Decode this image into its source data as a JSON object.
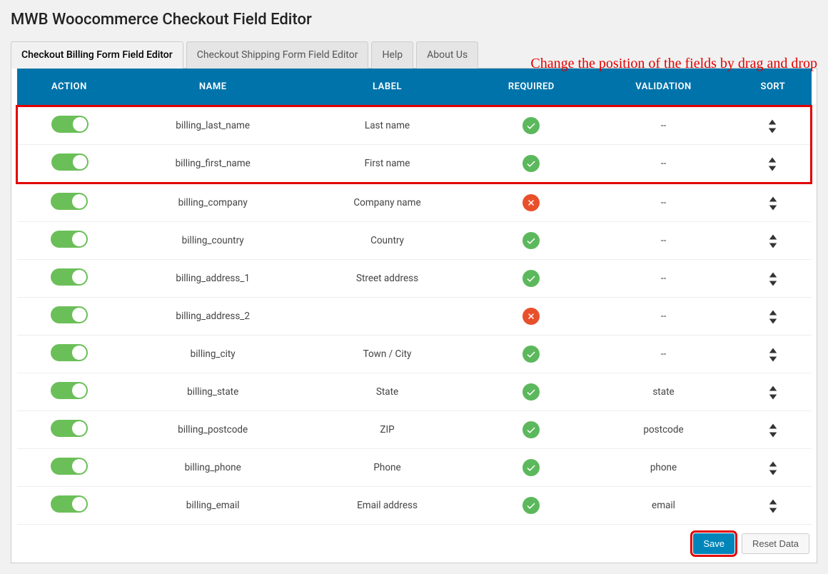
{
  "page_title": "MWB Woocommerce Checkout Field Editor",
  "annotation": "Change the position of the fields by drag and drop",
  "tabs": [
    {
      "label": "Checkout Billing Form Field Editor",
      "active": true
    },
    {
      "label": "Checkout Shipping Form Field Editor",
      "active": false
    },
    {
      "label": "Help",
      "active": false
    },
    {
      "label": "About Us",
      "active": false
    }
  ],
  "columns": [
    "Action",
    "Name",
    "Label",
    "Required",
    "Validation",
    "Sort"
  ],
  "rows_highlighted": [
    {
      "action_on": true,
      "name": "billing_last_name",
      "label": "Last name",
      "required": true,
      "validation": "--"
    },
    {
      "action_on": true,
      "name": "billing_first_name",
      "label": "First name",
      "required": true,
      "validation": "--"
    }
  ],
  "rows": [
    {
      "action_on": true,
      "name": "billing_company",
      "label": "Company name",
      "required": false,
      "validation": "--"
    },
    {
      "action_on": true,
      "name": "billing_country",
      "label": "Country",
      "required": true,
      "validation": "--"
    },
    {
      "action_on": true,
      "name": "billing_address_1",
      "label": "Street address",
      "required": true,
      "validation": "--"
    },
    {
      "action_on": true,
      "name": "billing_address_2",
      "label": "",
      "required": false,
      "validation": "--"
    },
    {
      "action_on": true,
      "name": "billing_city",
      "label": "Town / City",
      "required": true,
      "validation": "--"
    },
    {
      "action_on": true,
      "name": "billing_state",
      "label": "State",
      "required": true,
      "validation": "state"
    },
    {
      "action_on": true,
      "name": "billing_postcode",
      "label": "ZIP",
      "required": true,
      "validation": "postcode"
    },
    {
      "action_on": true,
      "name": "billing_phone",
      "label": "Phone",
      "required": true,
      "validation": "phone"
    },
    {
      "action_on": true,
      "name": "billing_email",
      "label": "Email address",
      "required": true,
      "validation": "email"
    }
  ],
  "buttons": {
    "save": "Save",
    "reset": "Reset Data"
  }
}
